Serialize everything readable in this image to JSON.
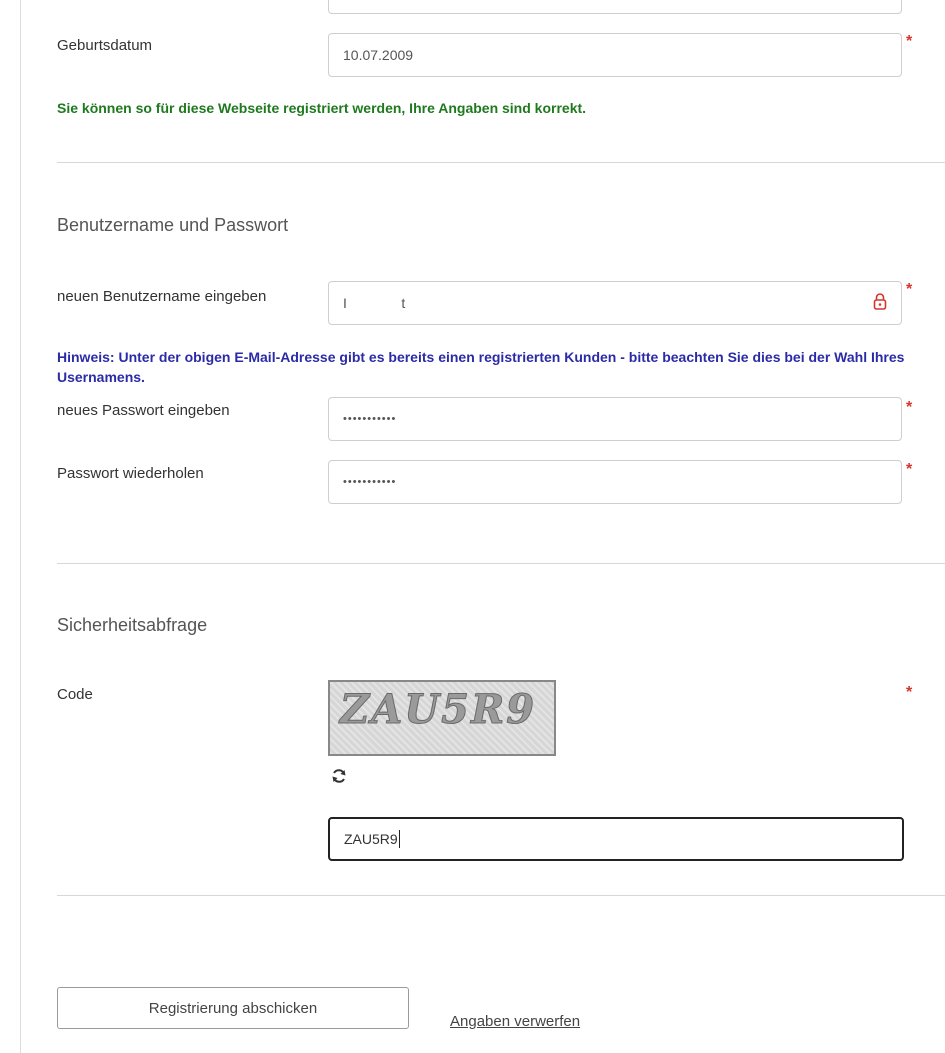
{
  "form": {
    "birthdate": {
      "label": "Geburtsdatum",
      "value": "10.07.2009",
      "required_mark": "*"
    },
    "success_message": "Sie können so für diese Webseite registriert werden, Ihre Angaben sind korrekt.",
    "credentials_section": {
      "title": "Benutzername und Passwort",
      "username": {
        "label": "neuen Benutzername eingeben",
        "value": "I              t",
        "required_mark": "*",
        "icon": "lock-icon"
      },
      "hint": "Hinweis: Unter der obigen E-Mail-Adresse gibt es bereits einen registrierten Kunden - bitte beachten Sie dies bei der Wahl Ihres Usernamens.",
      "password": {
        "label": "neues Passwort eingeben",
        "value": "•••••••••••",
        "required_mark": "*"
      },
      "password_repeat": {
        "label": "Passwort wiederholen",
        "value": "•••••••••••",
        "required_mark": "*"
      }
    },
    "security_section": {
      "title": "Sicherheitsabfrage",
      "code_label": "Code",
      "captcha_text": "ZAU5R9",
      "refresh_icon": "refresh-icon",
      "code_value": "ZAU5R9",
      "required_mark": "*"
    },
    "actions": {
      "submit_label": "Registrierung abschicken",
      "discard_label": "Angaben verwerfen"
    }
  },
  "colors": {
    "success": "#1f7a1f",
    "hint": "#2b2ba8",
    "required": "#d9332b"
  }
}
